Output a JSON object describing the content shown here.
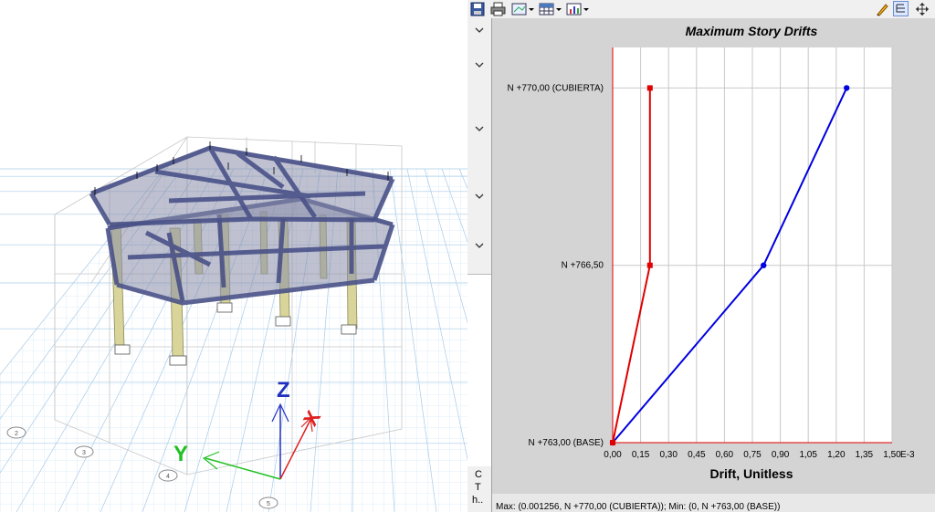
{
  "model_view": {
    "axis_labels": {
      "z": "Z",
      "x": "X",
      "y": "Y"
    },
    "grid_bubbles": [
      "2",
      "3",
      "4",
      "5"
    ],
    "colors": {
      "frame": "#4a5288",
      "slab": "#8a8eaa",
      "column": "#d8d49a",
      "grid": "#b8d8f0",
      "axis_z": "#2030c0",
      "axis_x": "#e02020",
      "axis_y": "#20c020"
    }
  },
  "toolbar": {
    "icons": [
      "save-icon",
      "print-icon",
      "display-icon",
      "table-icon",
      "chart-type-icon",
      "pencil-icon",
      "tree-icon",
      "move-icon"
    ]
  },
  "side_strip": {
    "letters": [
      "C",
      "T",
      "h.."
    ]
  },
  "status": {
    "text": "Max: (0.001256, N +770,00 (CUBIERTA)); Min: (0, N +763,00 (BASE))"
  },
  "chart_data": {
    "type": "line",
    "title": "Maximum Story Drifts",
    "xlabel": "Drift, Unitless",
    "ylabel": "",
    "x_ticks": [
      "0,00",
      "0,15",
      "0,30",
      "0,45",
      "0,60",
      "0,75",
      "0,90",
      "1,05",
      "1,20",
      "1,35",
      "1,50"
    ],
    "x_ticks_values": [
      0,
      0.15,
      0.3,
      0.45,
      0.6,
      0.75,
      0.9,
      1.05,
      1.2,
      1.35,
      1.5
    ],
    "x_exponent_label": "E-3",
    "xlim": [
      0,
      1.5
    ],
    "y_ticks": [
      "N +763,00 (BASE)",
      "N +766,50",
      "N +770,00 (CUBIERTA)"
    ],
    "y_ticks_values": [
      763,
      766.5,
      770
    ],
    "ylim": [
      763,
      770.8
    ],
    "grid": true,
    "series": [
      {
        "color": "#0000e0",
        "marker": "circle",
        "x": [
          0,
          0.81,
          1.256
        ],
        "y": [
          763,
          766.5,
          770
        ]
      },
      {
        "color": "#e00000",
        "marker": "square",
        "x": [
          0,
          0.2,
          0.2
        ],
        "y": [
          763,
          766.5,
          770
        ]
      }
    ]
  }
}
